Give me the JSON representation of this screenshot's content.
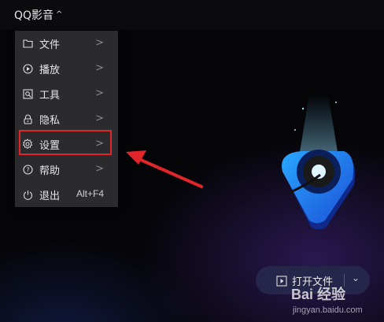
{
  "app": {
    "title": "QQ影音",
    "caret": "^"
  },
  "menu": {
    "items": [
      {
        "label": "文件",
        "icon": "folder-icon",
        "arrow": ">"
      },
      {
        "label": "播放",
        "icon": "play-circle-icon",
        "arrow": ">"
      },
      {
        "label": "工具",
        "icon": "tools-icon",
        "arrow": ">"
      },
      {
        "label": "隐私",
        "icon": "lock-icon",
        "arrow": ">"
      },
      {
        "label": "设置",
        "icon": "gear-icon",
        "arrow": ">"
      },
      {
        "label": "帮助",
        "icon": "help-icon",
        "arrow": ">"
      },
      {
        "label": "退出",
        "icon": "power-icon",
        "shortcut": "Alt+F4"
      }
    ]
  },
  "open_file": {
    "label": "打开文件",
    "dropdown": "⌄"
  },
  "watermark": {
    "logo": "Bai 经验",
    "url": "jingyan.baidu.com"
  },
  "colors": {
    "highlight": "#e0262b",
    "menu_bg": "#2b2b2e",
    "accent": "#1e90ff"
  }
}
